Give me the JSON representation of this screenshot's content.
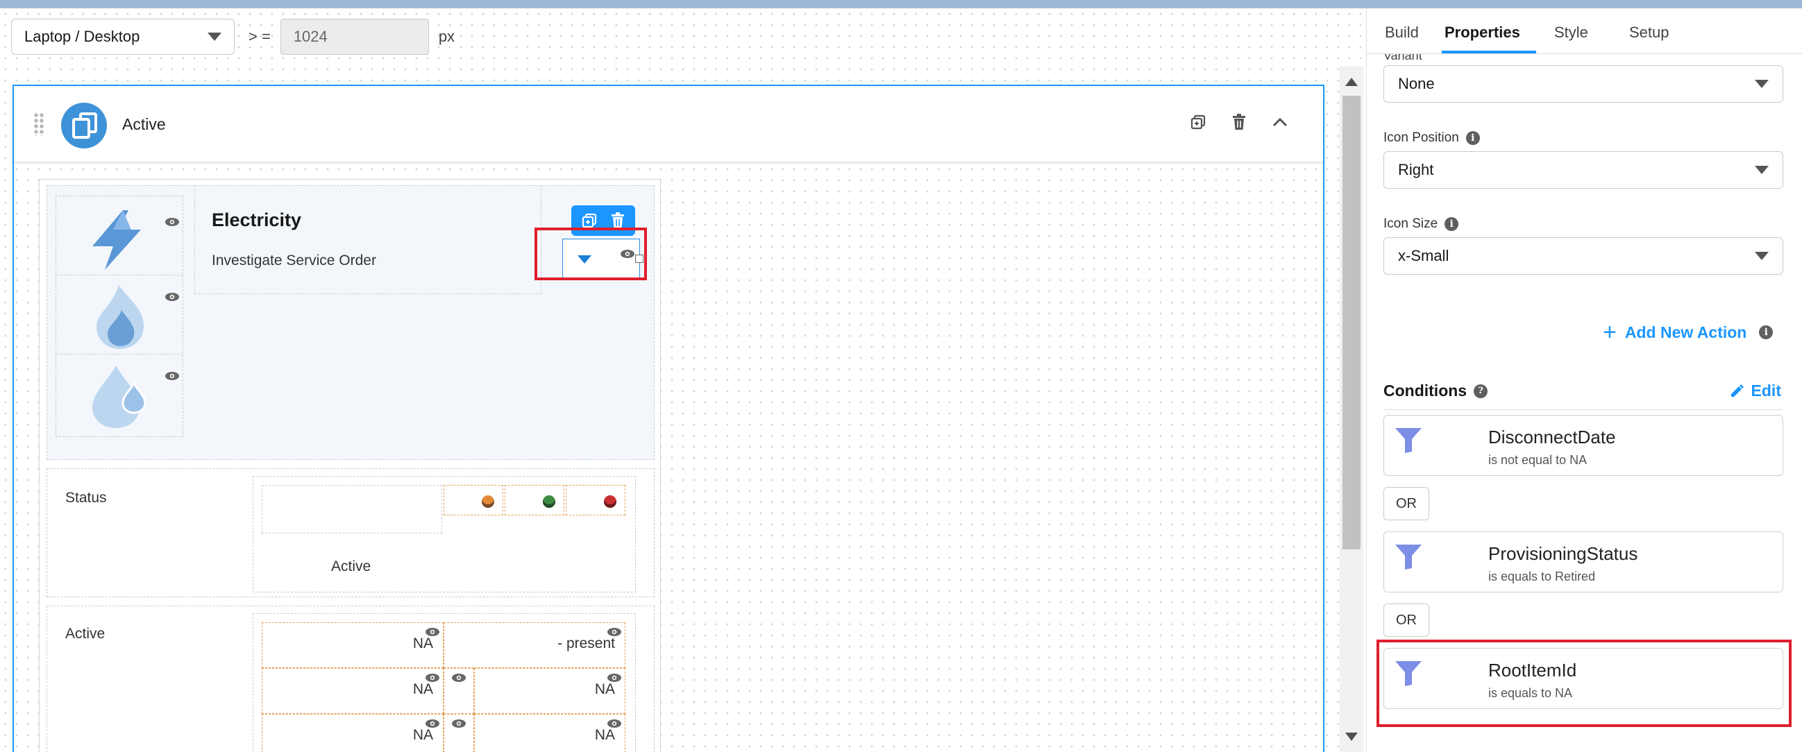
{
  "toolbar": {
    "device": "Laptop / Desktop",
    "operator": "> =",
    "width_value": "1024",
    "unit": "px"
  },
  "block": {
    "title": "Active"
  },
  "card": {
    "title": "Electricity",
    "subtitle": "Investigate Service Order"
  },
  "status_section": {
    "label": "Status",
    "value": "Active",
    "dot_colors": [
      "#e08a3a",
      "#3f8a43",
      "#c93131"
    ]
  },
  "active_section": {
    "label": "Active",
    "cells": [
      "NA",
      "- present",
      "NA",
      "NA",
      "NA",
      "NA"
    ]
  },
  "panel": {
    "tabs": [
      "Build",
      "Properties",
      "Style",
      "Setup"
    ],
    "active_tab": "Properties",
    "partial_label": "Variant",
    "variant_value": "None",
    "icon_position_label": "Icon Position",
    "icon_position_value": "Right",
    "icon_size_label": "Icon Size",
    "icon_size_value": "x-Small",
    "add_action": "Add New Action",
    "conditions_title": "Conditions",
    "edit": "Edit",
    "or_label": "OR",
    "conditions": [
      {
        "field": "DisconnectDate",
        "desc": "is not equal to NA"
      },
      {
        "field": "ProvisioningStatus",
        "desc": "is equals to Retired"
      },
      {
        "field": "RootItemId",
        "desc": "is equals to NA"
      }
    ]
  },
  "colors": {
    "accent": "#1b96ff",
    "highlight": "#e01e2d",
    "filter_icon": "#7c8ee6"
  }
}
